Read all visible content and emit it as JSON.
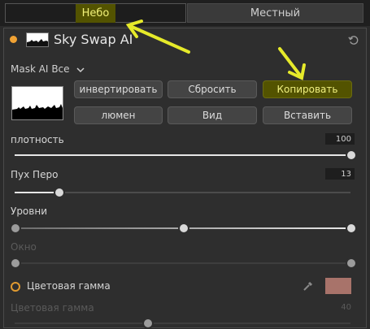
{
  "tabs": [
    {
      "label": "Небо",
      "active": true
    },
    {
      "label": "Местный",
      "active": false
    }
  ],
  "panel": {
    "title": "Sky Swap AI",
    "status_color": "#f0a234",
    "mask_dropdown": {
      "prefix": "Mask AI",
      "value": "Все"
    }
  },
  "buttons": {
    "invert": "инвертировать",
    "reset": "Сбросить",
    "copy": "Копировать",
    "lumen": "люмен",
    "view": "Вид",
    "paste": "Вставить"
  },
  "sliders": {
    "density": {
      "label": "плотность",
      "value": "100",
      "fraction": 1.0
    },
    "feather": {
      "label": "Пух Перо",
      "value": "13",
      "fraction": 0.13
    },
    "levels": {
      "label": "Уровни",
      "black": 0.0,
      "mid": 0.5,
      "white": 1.0
    },
    "window": {
      "label": "Окно",
      "low": 0.0,
      "high": 1.0
    }
  },
  "color_gamut": {
    "label": "Цветовая гамма",
    "swatch_color": "#a8736a",
    "sub_label": "Цветовая гамма",
    "sub_value": "40"
  },
  "accent_highlight": "#535300",
  "annotation_arrow_color": "#e6ea2a"
}
